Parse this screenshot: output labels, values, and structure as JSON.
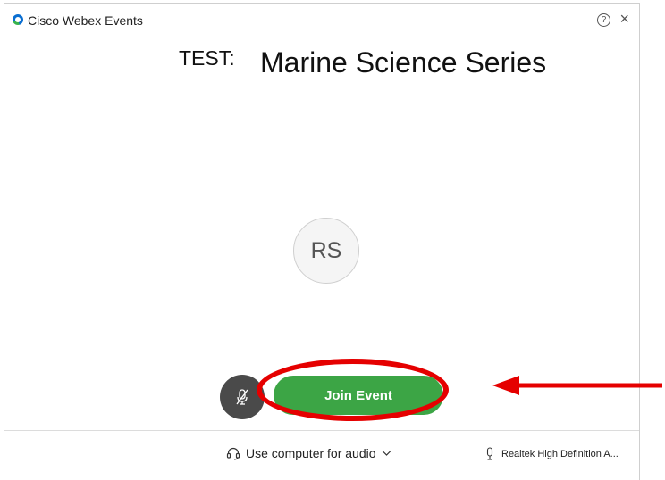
{
  "window": {
    "title": "Cisco Webex Events",
    "help_icon": "?",
    "close_icon": "×"
  },
  "event": {
    "prefix": "TEST:",
    "title": "Marine Science Series"
  },
  "user": {
    "initials": "RS"
  },
  "controls": {
    "mute_icon": "microphone-muted-icon",
    "join_label": "Join Event"
  },
  "audio": {
    "option_label": "Use computer for audio",
    "microphone_label": "Realtek High Definition A..."
  },
  "annotation": {
    "highlight_color": "#e50000",
    "arrow_color": "#e50000"
  },
  "colors": {
    "join_button": "#3ca545",
    "mute_button": "#4a4a4a"
  }
}
